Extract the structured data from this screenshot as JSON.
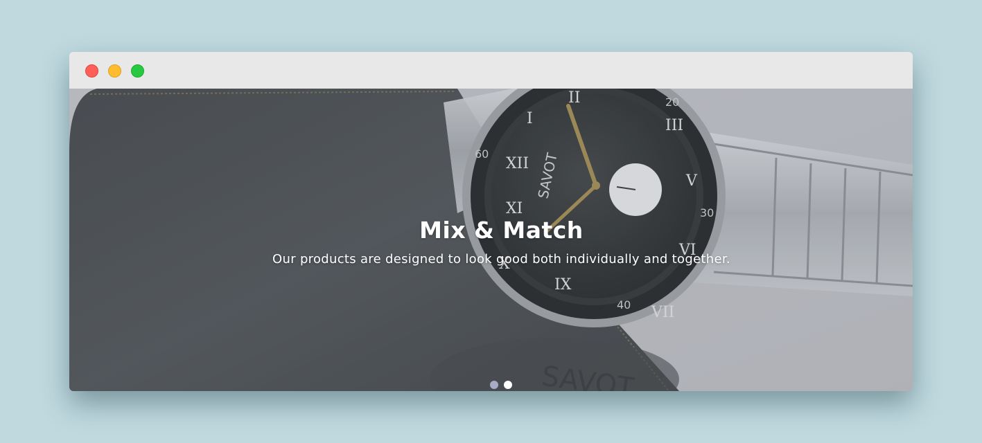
{
  "window": {
    "controls": [
      "close",
      "minimize",
      "zoom"
    ]
  },
  "carousel": {
    "slide": {
      "title": "Mix & Match",
      "subtitle": "Our products are designed to look good both individually and together.",
      "image": {
        "wallet_logo": "SAVOT",
        "watch_logo": "SAVOT"
      }
    },
    "indicators": {
      "count": 2,
      "active_index": 1
    }
  },
  "colors": {
    "background": "#bfd9df",
    "titlebar": "#e8e8e8",
    "close": "#ff5f57",
    "minimize": "#febc2e",
    "zoom": "#28c840",
    "caption_text": "#ffffff",
    "indicator_active": "#ffffff",
    "indicator_inactive": "#a7abc3"
  }
}
